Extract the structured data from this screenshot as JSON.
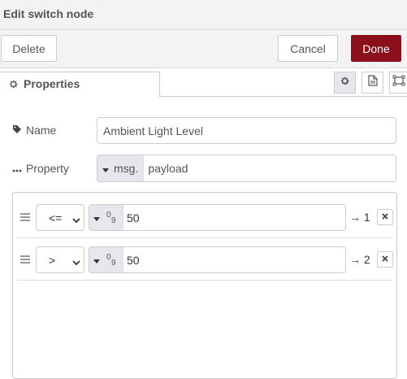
{
  "header": {
    "title": "Edit switch node"
  },
  "toolbar": {
    "delete_label": "Delete",
    "cancel_label": "Cancel",
    "done_label": "Done",
    "done_color": "#8c101c"
  },
  "tabs": {
    "properties_label": "Properties"
  },
  "form": {
    "name_label": "Name",
    "name_value": "Ambient Light Level",
    "property_label": "Property",
    "property_type": "msg.",
    "property_value": "payload"
  },
  "rules": [
    {
      "operator": "<=",
      "value_type_icon": "number-type-icon",
      "value": "50",
      "output": "→ 1"
    },
    {
      "operator": ">",
      "value_type_icon": "number-type-icon",
      "value": "50",
      "output": "→ 2"
    }
  ]
}
